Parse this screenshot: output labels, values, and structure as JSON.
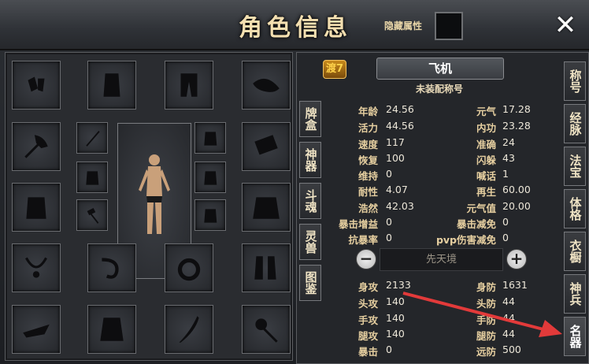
{
  "window": {
    "title": "角色信息",
    "hide_label": "隐藏属性",
    "close_icon": "close-icon"
  },
  "character": {
    "level_badge": "渡7",
    "name": "飞机",
    "title": "未装配称号"
  },
  "left_tabs": [
    "牌盒",
    "神器",
    "斗魂",
    "灵兽",
    "图鉴"
  ],
  "right_tabs": [
    "称号",
    "经脉",
    "法宝",
    "体格",
    "衣橱",
    "神兵",
    "名器"
  ],
  "stats_left": [
    {
      "k": "年龄",
      "v": "24.56"
    },
    {
      "k": "活力",
      "v": "44.56"
    },
    {
      "k": "速度",
      "v": "117"
    },
    {
      "k": "恢复",
      "v": "100"
    },
    {
      "k": "维持",
      "v": "0"
    },
    {
      "k": "耐性",
      "v": "4.07"
    },
    {
      "k": "浩然",
      "v": "42.03"
    },
    {
      "k": "暴击增益",
      "v": "0"
    },
    {
      "k": "抗暴率",
      "v": "0"
    }
  ],
  "stats_right": [
    {
      "k": "元气",
      "v": "17.28"
    },
    {
      "k": "内功",
      "v": "23.28"
    },
    {
      "k": "准确",
      "v": "24"
    },
    {
      "k": "闪躲",
      "v": "43"
    },
    {
      "k": "喊话",
      "v": "1"
    },
    {
      "k": "再生",
      "v": "60.00"
    },
    {
      "k": "元气值",
      "v": "20.00"
    },
    {
      "k": "暴击减免",
      "v": "0"
    },
    {
      "k": "pvp伤害减免",
      "v": "0"
    }
  ],
  "realm": {
    "label": "先天境",
    "minus": "−",
    "plus": "+"
  },
  "combat_left": [
    {
      "k": "身攻",
      "v": "2133"
    },
    {
      "k": "头攻",
      "v": "140"
    },
    {
      "k": "手攻",
      "v": "140"
    },
    {
      "k": "腿攻",
      "v": "140"
    },
    {
      "k": "暴击",
      "v": "0"
    }
  ],
  "combat_right": [
    {
      "k": "身防",
      "v": "1631"
    },
    {
      "k": "头防",
      "v": "44"
    },
    {
      "k": "手防",
      "v": "44"
    },
    {
      "k": "腿防",
      "v": "44"
    },
    {
      "k": "远防",
      "v": "500"
    }
  ],
  "equipment_slots": [
    "gloves-icon",
    "vest-icon",
    "pants-icon",
    "hat-icon",
    "axe-icon",
    "staff-icon",
    "armor-icon",
    "armor-icon",
    "armor-icon",
    "bracer-icon",
    "armor-icon",
    "armor-icon",
    "hammer-icon",
    "armor-icon",
    "jacket-icon",
    "necklace-icon",
    "whip-icon",
    "ring-icon",
    "boots-icon",
    "ship-icon",
    "coat-icon",
    "blade-icon",
    "mace-icon"
  ],
  "colors": {
    "accent": "#f3dfb0",
    "arrow": "#e23a3a"
  }
}
